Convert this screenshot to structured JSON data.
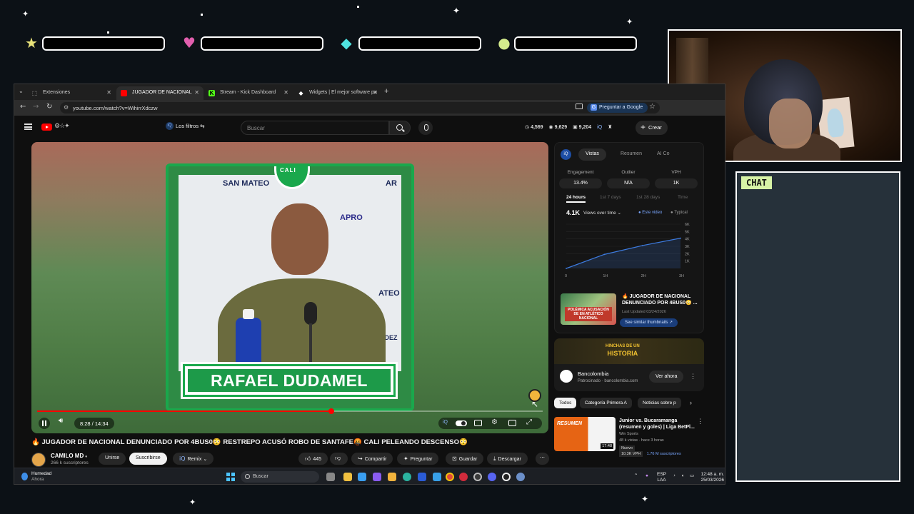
{
  "overlay": {
    "chat_label": "CHAT"
  },
  "browser": {
    "tabs": [
      {
        "label": "Extensiones"
      },
      {
        "label": "JUGADOR DE NACIONAL"
      },
      {
        "label": "Stream - Kick Dashboard"
      },
      {
        "label": "Widgets | El mejor software pa"
      }
    ],
    "url": "youtube.com/watch?v=WihirrXdczw",
    "ask_google": "Preguntar a Google"
  },
  "youtube": {
    "filters_label": "Los filtros",
    "search_placeholder": "Buscar",
    "header_stats": [
      "4,569",
      "9,629",
      "9,204"
    ],
    "create_label": "Crear",
    "player": {
      "name_graphic": "RAFAEL DUDAMEL",
      "sponsors": [
        "SAN MATEO",
        "AR",
        "APRO",
        "ATEO",
        "NDEZ"
      ],
      "current_time": "8:28",
      "duration": "14:34",
      "time_display": "8:28 / 14:34",
      "progress": 0.582
    },
    "video_title": "🔥 JUGADOR DE NACIONAL DENUNCIADO POR 4BUS0😳 RESTREPO ACUSÓ ROBO DE SANTAFE🤬 CALI PELEANDO DESCENSO😳",
    "channel": {
      "name": "CAMILO MD",
      "subs": "266 k suscriptores"
    },
    "actions": {
      "join": "Unirse",
      "subscribe": "Suscribirse",
      "remix": "Remix",
      "likes": "445",
      "share": "Compartir",
      "ask": "Preguntar",
      "save": "Guardar",
      "download": "Descargar"
    },
    "sidebar": {
      "panel_tabs": [
        "Vistas",
        "Resumen",
        "AI Co"
      ],
      "metrics": [
        {
          "label": "Engagement",
          "value": "13.4%"
        },
        {
          "label": "Outlier",
          "value": "N/A"
        },
        {
          "label": "VPH",
          "value": "1K"
        }
      ],
      "range_tabs": [
        "24 hours",
        "1st 7 days",
        "1st 28 days",
        "Time"
      ],
      "views_total": "4.1K",
      "views_selector": "Views over time",
      "legend": [
        "Este video",
        "Typical"
      ],
      "chart_data": {
        "type": "line",
        "x": [
          "0",
          "1H",
          "2H",
          "3H"
        ],
        "xlabel": "",
        "ylabel": "",
        "y_ticks": [
          "6K",
          "5K",
          "4K",
          "3K",
          "2K",
          "1K"
        ],
        "ylim": [
          0,
          6000
        ],
        "series": [
          {
            "name": "Este video",
            "x": [
              0,
              1,
              2,
              3
            ],
            "values": [
              0,
              1900,
              3100,
              4100
            ]
          }
        ]
      },
      "related": {
        "title": "🔥 JUGADOR DE NACIONAL DENUNCIADO POR 4BUS0😳 ...",
        "meta": "Last Updated 03/24/2026",
        "button": "See similar thumbnails",
        "thumb_caption": "POLÉMICA ACUSACIÓN DE EN ATLÉTICO NACIONAL"
      },
      "ad": {
        "banner_line1": "HINCHAS DE UN",
        "banner_line2": "HISTORIA",
        "name": "Bancolombia",
        "sponsor": "Patrocinado · bancolombia.com",
        "button": "Ver ahora"
      },
      "chips": [
        "Todos",
        "Categoría Primera A",
        "Noticias sobre p"
      ],
      "recommendation": {
        "thumb_label": "RESUMEN",
        "duration": "17:48",
        "title": "Junior vs. Bucaramanga (resumen y goles) | Liga BetPl...",
        "channel": "Win Sports",
        "stats": "48 k vistas · hace 3 horas",
        "badge": "Nuevo",
        "vph": "10.3K VPH",
        "vph_extra": "1.76 M suscriptores"
      }
    }
  },
  "taskbar": {
    "weather_title": "Humedad",
    "weather_sub": "Ahora",
    "search": "Buscar",
    "lang": "ESP",
    "lang_sub": "LAA",
    "time": "12:48 a. m.",
    "date": "25/03/2026"
  },
  "colors": {
    "accent_red": "#ff0000",
    "club_green": "#1d9a49",
    "chat_label": "#d7f3a6",
    "chart_line": "#3d7be0"
  }
}
